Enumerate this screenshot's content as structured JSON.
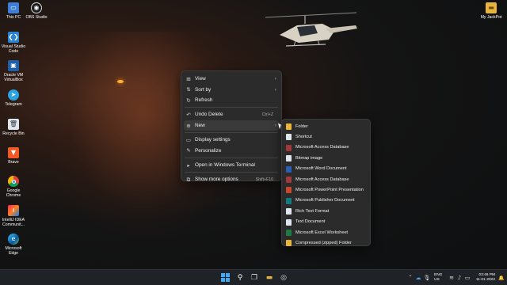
{
  "desktop_icons": {
    "this_pc": "This PC",
    "obs": "OBS Studio",
    "vscode": "Visual Studio Code",
    "virtualbox": "Oracle VM VirtualBox",
    "telegram": "Telegram",
    "recycle": "Recycle Bin",
    "brave": "Brave",
    "chrome": "Google Chrome",
    "intellij": "IntelliJ IDEA Communit...",
    "edge": "Microsoft Edge",
    "my_jackpot": "My JackPot"
  },
  "context_menu": {
    "view": "View",
    "sort_by": "Sort by",
    "refresh": "Refresh",
    "undo_delete": "Undo Delete",
    "undo_shortcut": "Ctrl+Z",
    "new": "New",
    "display_settings": "Display settings",
    "personalize": "Personalize",
    "open_terminal": "Open in Windows Terminal",
    "show_more": "Show more options",
    "show_more_shortcut": "Shift+F10"
  },
  "new_submenu": [
    {
      "label": "Folder",
      "color": "#e8b53a"
    },
    {
      "label": "Shortcut",
      "color": "#e0e6ee"
    },
    {
      "label": "Microsoft Access Database",
      "color": "#a4373a"
    },
    {
      "label": "Bitmap image",
      "color": "#dfe6ef"
    },
    {
      "label": "Microsoft Word Document",
      "color": "#2b5fb4"
    },
    {
      "label": "Microsoft Access Database",
      "color": "#a4373a"
    },
    {
      "label": "Microsoft PowerPoint Presentation",
      "color": "#c9482b"
    },
    {
      "label": "Microsoft Publisher Document",
      "color": "#137a7f"
    },
    {
      "label": "Rich Text Format",
      "color": "#dfe6ef"
    },
    {
      "label": "Text Document",
      "color": "#dfe6ef"
    },
    {
      "label": "Microsoft Excel Worksheet",
      "color": "#1e7a45"
    },
    {
      "label": "Compressed (zipped) Folder",
      "color": "#e8b53a"
    }
  ],
  "tray": {
    "lang": "ENG",
    "region": "US",
    "time": "03:46 PM",
    "date": "11-01-2022"
  }
}
